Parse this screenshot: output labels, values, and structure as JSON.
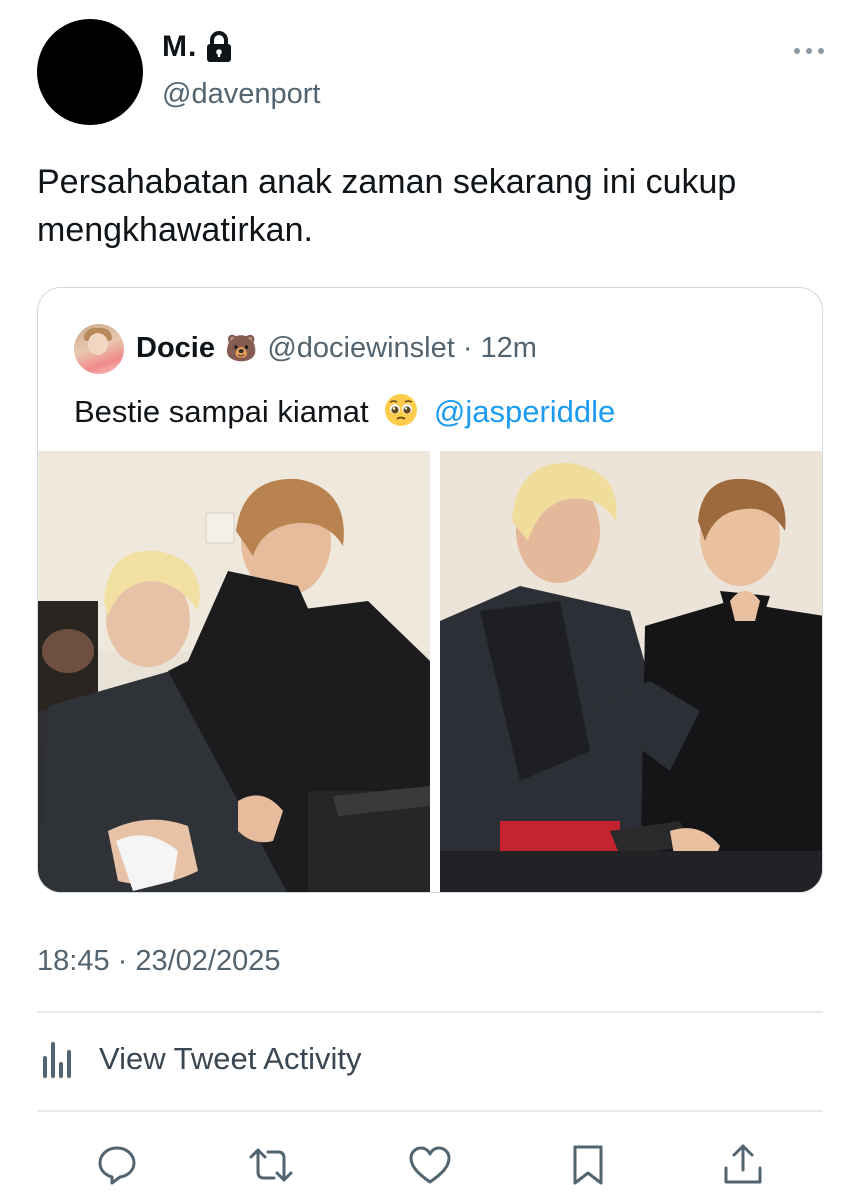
{
  "author": {
    "display_name": "M.",
    "handle": "@davenport",
    "protected": true
  },
  "tweet": {
    "text": "Persahabatan anak zaman sekarang ini cukup mengkhawatirkan.",
    "timestamp": "18:45 · 23/02/2025"
  },
  "quoted_tweet": {
    "display_name": "Docie",
    "name_emoji": "🐻",
    "handle_time": "@dociewinslet · 12m",
    "text": "Bestie sampai kiamat",
    "mention": "@jasperiddle",
    "photos": [
      "photo-left",
      "photo-right"
    ]
  },
  "activity": {
    "label": "View Tweet Activity"
  },
  "actions": [
    {
      "name": "reply",
      "icon": "reply-icon"
    },
    {
      "name": "retweet",
      "icon": "retweet-icon"
    },
    {
      "name": "like",
      "icon": "heart-icon"
    },
    {
      "name": "bookmark",
      "icon": "bookmark-icon"
    },
    {
      "name": "share",
      "icon": "share-icon"
    }
  ],
  "colors": {
    "text_primary": "#0f1419",
    "text_secondary": "#536471",
    "link": "#1d9bf0",
    "border": "#cfd9de"
  }
}
